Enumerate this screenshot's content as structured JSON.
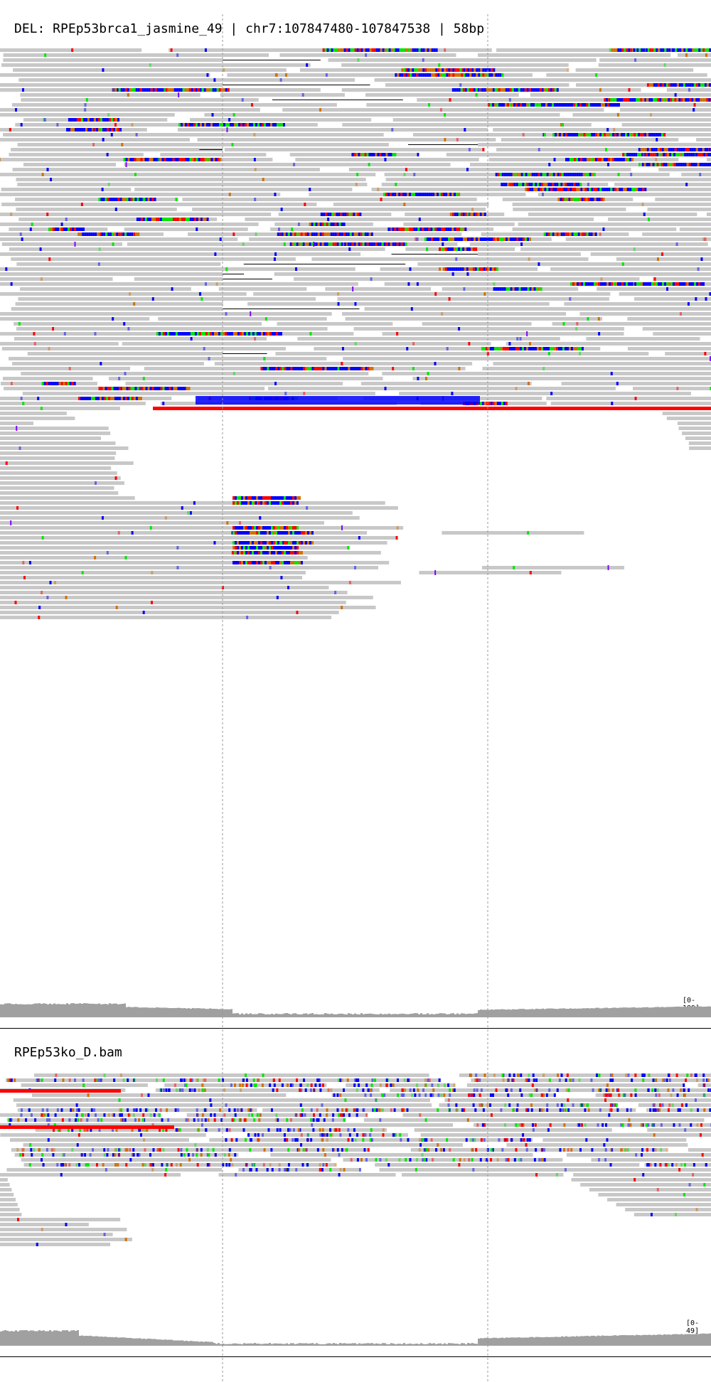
{
  "panels": [
    {
      "title": "DEL: RPEp53brca1_jasmine_49 | chr7:107847480-107847538 | 58bp",
      "coverage_range": "[0-189]"
    },
    {
      "title": "RPEp53ko_D.bam",
      "coverage_range": "[0-49]"
    }
  ],
  "colors": {
    "read": "#c8c8c8",
    "mismatch_a": "#00e600",
    "mismatch_c": "#0000ff",
    "mismatch_g": "#d17105",
    "mismatch_t": "#ff0000",
    "insertion": "#8000ff",
    "deletion": "#000000",
    "coverage": "#a0a0a0",
    "guide": "#999999"
  }
}
